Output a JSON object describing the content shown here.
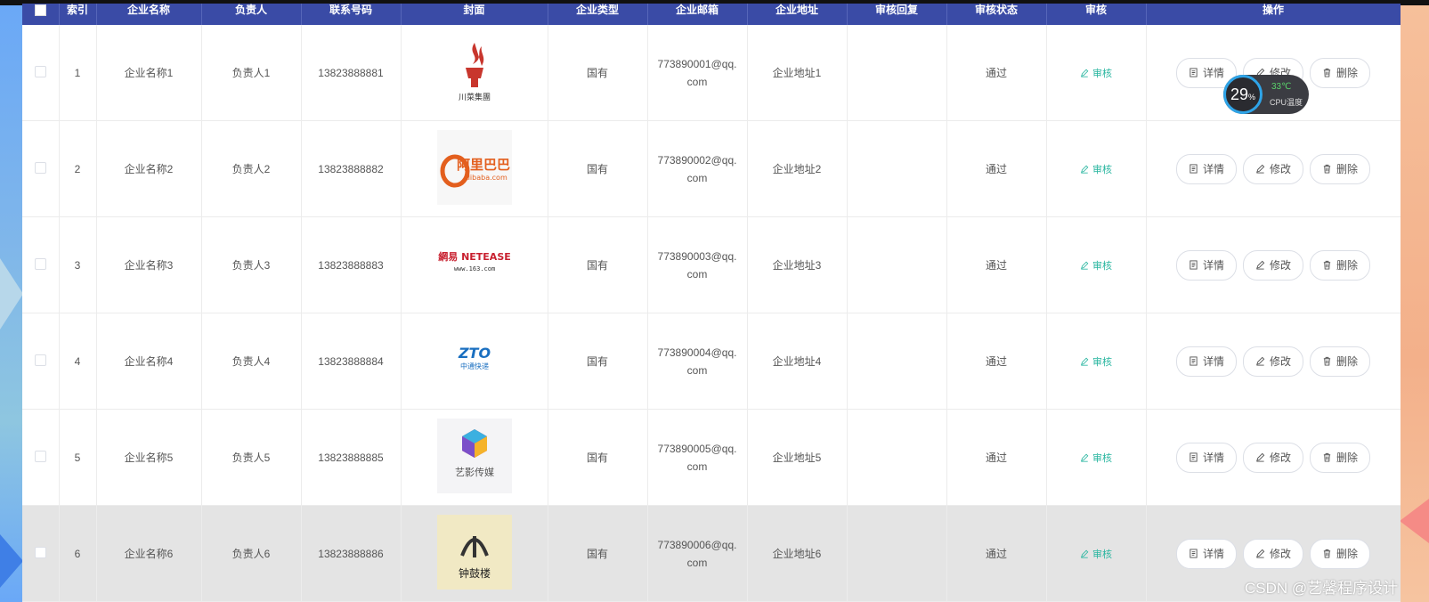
{
  "columns": [
    "索引",
    "企业名称",
    "负责人",
    "联系号码",
    "封面",
    "企业类型",
    "企业邮箱",
    "企业地址",
    "审核回复",
    "审核状态",
    "审核",
    "操作"
  ],
  "rows": [
    {
      "index": "1",
      "name": "企业名称1",
      "owner": "负责人1",
      "phone": "13823888881",
      "cover_text": "川菜集團",
      "type": "国有",
      "email_1": "773890001@qq.",
      "email_2": "com",
      "address": "企业地址1",
      "reply": "",
      "status": "通过"
    },
    {
      "index": "2",
      "name": "企业名称2",
      "owner": "负责人2",
      "phone": "13823888882",
      "cover_text": "阿里巴巴",
      "cover_sub": "Alibaba.com",
      "type": "国有",
      "email_1": "773890002@qq.",
      "email_2": "com",
      "address": "企业地址2",
      "reply": "",
      "status": "通过"
    },
    {
      "index": "3",
      "name": "企业名称3",
      "owner": "负责人3",
      "phone": "13823888883",
      "cover_text": "網易 NETEASE",
      "cover_sub": "www.163.com",
      "type": "国有",
      "email_1": "773890003@qq.",
      "email_2": "com",
      "address": "企业地址3",
      "reply": "",
      "status": "通过"
    },
    {
      "index": "4",
      "name": "企业名称4",
      "owner": "负责人4",
      "phone": "13823888884",
      "cover_text": "ZTO",
      "cover_sub": "中通快递",
      "type": "国有",
      "email_1": "773890004@qq.",
      "email_2": "com",
      "address": "企业地址4",
      "reply": "",
      "status": "通过"
    },
    {
      "index": "5",
      "name": "企业名称5",
      "owner": "负责人5",
      "phone": "13823888885",
      "cover_text": "艺影传媒",
      "type": "国有",
      "email_1": "773890005@qq.",
      "email_2": "com",
      "address": "企业地址5",
      "reply": "",
      "status": "通过"
    },
    {
      "index": "6",
      "name": "企业名称6",
      "owner": "负责人6",
      "phone": "13823888886",
      "cover_text": "钟鼓楼",
      "type": "国有",
      "email_1": "773890006@qq.",
      "email_2": "com",
      "address": "企业地址6",
      "reply": "",
      "status": "通过"
    }
  ],
  "actions": {
    "audit": "审核",
    "detail": "详情",
    "edit": "修改",
    "delete": "删除"
  },
  "cpu_widget": {
    "percent": "29",
    "percent_unit": "%",
    "temp": "33℃",
    "label": "CPU温度"
  },
  "watermark": "CSDN @艺馨程序设计",
  "colors": {
    "header": "#3a4ba6",
    "audit": "#29b6a0",
    "highlight_row": "#e4e4e4"
  }
}
